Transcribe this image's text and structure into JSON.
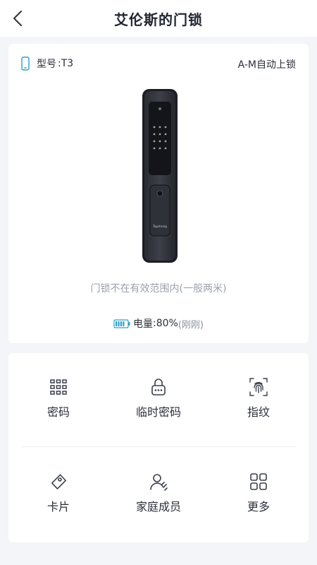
{
  "header": {
    "title": "艾伦斯的门锁"
  },
  "lock": {
    "model_label": "型号",
    "model_value": ":T3",
    "auto_lock": "A-M自动上锁",
    "range_text": "门锁不在有效范围内(一般两米)",
    "battery_label": "电量",
    "battery_value": ":80%",
    "battery_time": "(刚刚)",
    "battery_level": 0.8,
    "brand_text": "Topstrong"
  },
  "menu": {
    "items": [
      {
        "label": "密码",
        "icon": "keypad-icon"
      },
      {
        "label": "临时密码",
        "icon": "lock-dots-icon"
      },
      {
        "label": "指纹",
        "icon": "fingerprint-icon"
      },
      {
        "label": "卡片",
        "icon": "card-icon"
      },
      {
        "label": "家庭成员",
        "icon": "family-icon"
      },
      {
        "label": "更多",
        "icon": "grid-icon"
      }
    ]
  },
  "colors": {
    "accent": "#2aa0c8",
    "text": "#2b2f3a",
    "muted": "#9aa0ac",
    "background": "#f4f5f8"
  }
}
